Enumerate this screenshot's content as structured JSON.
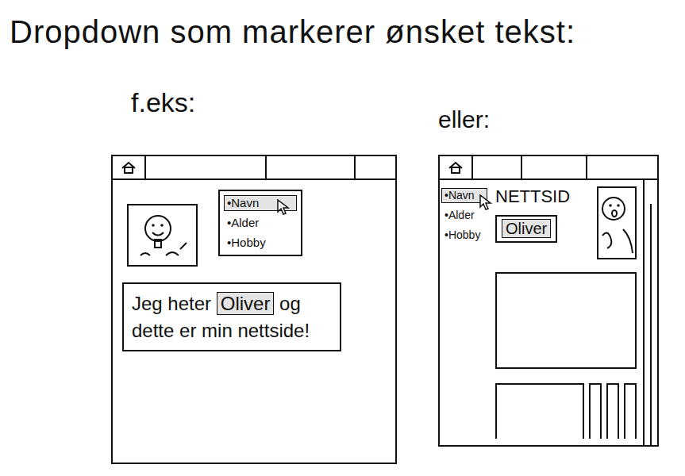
{
  "title": "Dropdown som markerer ønsket tekst:",
  "bullet": "•",
  "examples": [
    {
      "kind": "inline-text",
      "label": "f.eks:",
      "menu": [
        {
          "label": "Navn",
          "selected": true
        },
        {
          "label": "Alder",
          "selected": false
        },
        {
          "label": "Hobby",
          "selected": false
        }
      ],
      "text_before": "Jeg heter",
      "highlight": "Oliver",
      "text_after": "og dette er min nettside!"
    },
    {
      "kind": "page-layout",
      "label": "eller:",
      "menu": [
        {
          "label": "Navn",
          "selected": true
        },
        {
          "label": "Alder",
          "selected": false
        },
        {
          "label": "Hobby",
          "selected": false
        }
      ],
      "heading": "NETTSID",
      "highlight": "Oliver"
    }
  ]
}
